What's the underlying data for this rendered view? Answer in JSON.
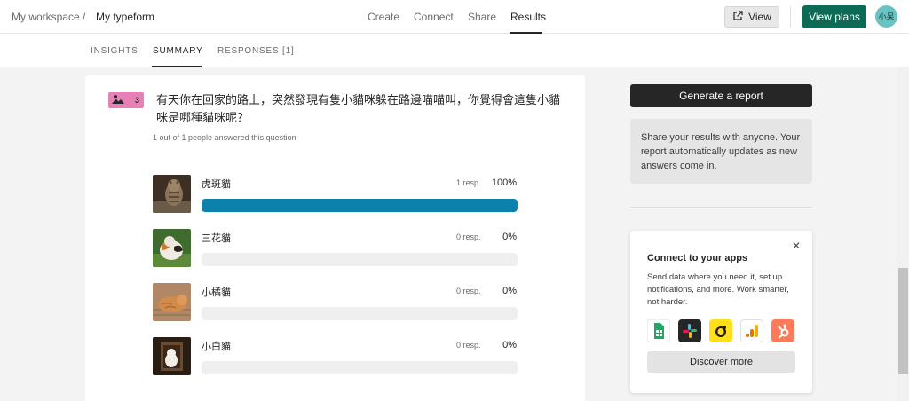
{
  "header": {
    "workspace": "My workspace",
    "separator": "/",
    "form_name": "My typeform",
    "nav": [
      "Create",
      "Connect",
      "Share",
      "Results"
    ],
    "view_label": "View",
    "plans_label": "View plans",
    "avatar_text": "小呆",
    "colors": {
      "plans": "#0d6b55",
      "avatar": "#69c3c3"
    }
  },
  "tabs": [
    "INSIGHTS",
    "SUMMARY",
    "RESPONSES [1]"
  ],
  "question": {
    "number": "3",
    "title": "有天你在回家的路上，突然發現有隻小貓咪躲在路邊喵喵叫，你覺得會這隻小貓咪是哪種貓咪呢？",
    "answered": "1 out of 1 people answered this question",
    "badge_color": "#e880b8",
    "options": [
      {
        "label": "虎斑貓",
        "resp": "1 resp.",
        "pct": "100%",
        "fill": 1.0,
        "image": "tabby-cat-photo"
      },
      {
        "label": "三花貓",
        "resp": "0 resp.",
        "pct": "0%",
        "fill": 0,
        "image": "calico-cat-photo"
      },
      {
        "label": "小橘貓",
        "resp": "0 resp.",
        "pct": "0%",
        "fill": 0,
        "image": "orange-cat-photo"
      },
      {
        "label": "小白貓",
        "resp": "0 resp.",
        "pct": "0%",
        "fill": 0,
        "image": "white-cat-photo"
      }
    ],
    "bar_color": "#0b81ac"
  },
  "sidebar": {
    "report_label": "Generate a report",
    "share_text": "Share your results with anyone. Your report automatically updates as new answers come in.",
    "apps": {
      "title": "Connect to your apps",
      "desc": "Send data where you need it, set up notifications, and more. Work smarter, not harder.",
      "discover_label": "Discover more",
      "icons": [
        "google-sheets-icon",
        "slack-icon",
        "mailchimp-icon",
        "google-analytics-icon",
        "hubspot-icon"
      ]
    }
  }
}
